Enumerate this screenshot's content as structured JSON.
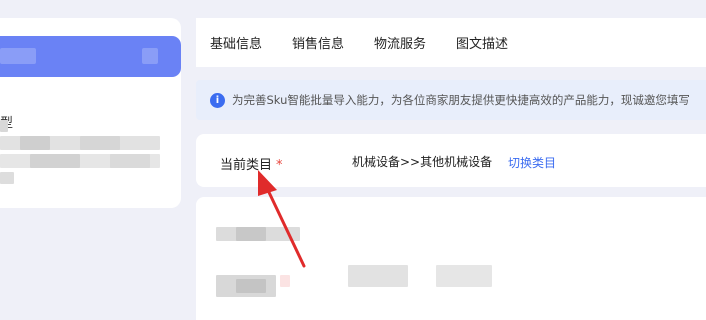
{
  "sidebar": {
    "type_label": "型"
  },
  "tabs": [
    {
      "label": "基础信息"
    },
    {
      "label": "销售信息"
    },
    {
      "label": "物流服务"
    },
    {
      "label": "图文描述"
    }
  ],
  "banner": {
    "icon": "info-icon",
    "text": "为完善Sku智能批量导入能力，为各位商家朋友提供更快捷高效的产品能力，现诚邀您填写"
  },
  "category": {
    "label": "当前类目",
    "required_mark": "*",
    "value": "机械设备>>其他机械设备",
    "switch_link": "切换类目"
  },
  "colors": {
    "accent": "#6a82f5",
    "link": "#3b6cf0",
    "required": "#e8453c",
    "annotation_arrow": "#e02b2b"
  }
}
